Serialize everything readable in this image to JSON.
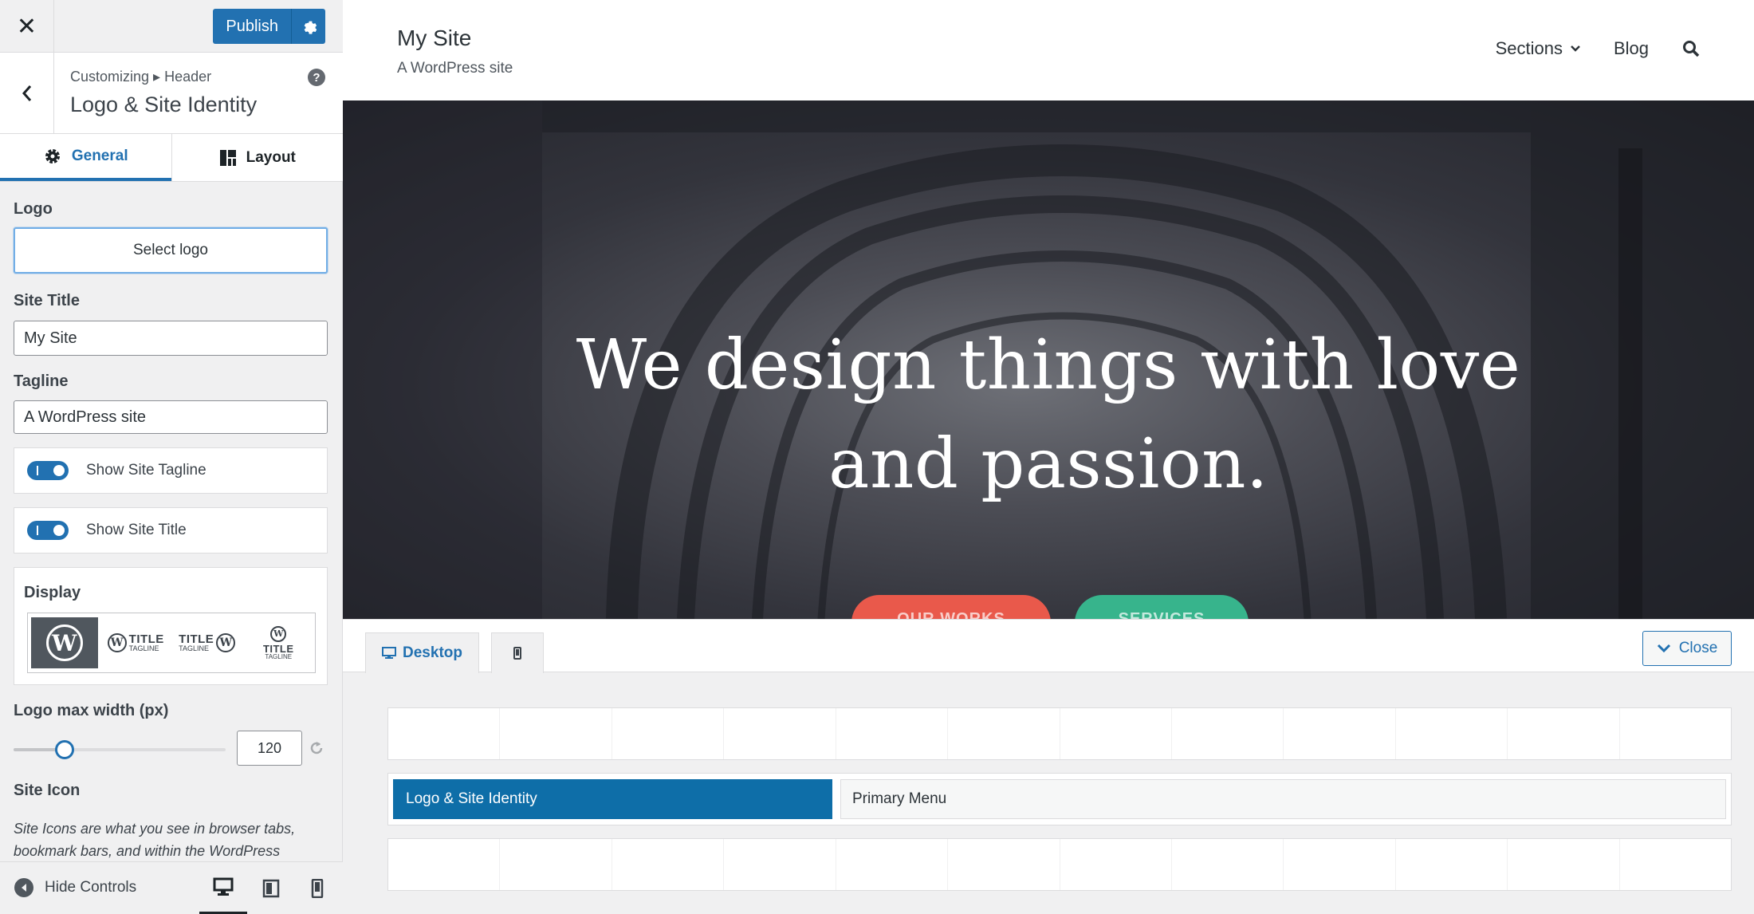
{
  "sidebar": {
    "publish_label": "Publish",
    "breadcrumb": "Customizing ▸ Header",
    "section_title": "Logo & Site Identity",
    "tabs": [
      {
        "label": "General",
        "icon": "gear-icon",
        "active": true
      },
      {
        "label": "Layout",
        "icon": "layout-icon",
        "active": false
      }
    ],
    "logo": {
      "label": "Logo",
      "button": "Select logo"
    },
    "site_title": {
      "label": "Site Title",
      "value": "My Site"
    },
    "tagline": {
      "label": "Tagline",
      "value": "A WordPress site"
    },
    "toggles": [
      {
        "label": "Show Site Tagline",
        "on": true
      },
      {
        "label": "Show Site Title",
        "on": true
      }
    ],
    "display": {
      "label": "Display",
      "options": [
        {
          "title": "",
          "tagline": "",
          "selected": true
        },
        {
          "title": "TITLE",
          "tagline": "TAGLINE",
          "selected": false
        },
        {
          "title": "TITLE",
          "tagline": "TAGLINE",
          "selected": false
        },
        {
          "title": "TITLE",
          "tagline": "TAGLINE",
          "selected": false
        }
      ]
    },
    "logo_max_width": {
      "label": "Logo max width (px)",
      "value": "120",
      "slider_fraction": 0.24
    },
    "site_icon": {
      "label": "Site Icon",
      "description": "Site Icons are what you see in browser tabs, bookmark bars, and within the WordPress"
    },
    "footer": {
      "hide_controls": "Hide Controls",
      "active_device": "desktop"
    }
  },
  "preview": {
    "site_title": "My Site",
    "site_tagline": "A WordPress site",
    "nav": {
      "sections": "Sections",
      "blog": "Blog"
    },
    "hero": {
      "heading_line1": "We design things with love",
      "heading_line2": "and passion.",
      "button1": "OUR WORKS",
      "button2": "SERVICES",
      "button1_color": "#e9594b",
      "button2_color": "#37b48c"
    }
  },
  "builder": {
    "tab_desktop": "Desktop",
    "close_label": "Close",
    "items": {
      "logo": "Logo & Site Identity",
      "menu": "Primary Menu"
    }
  },
  "colors": {
    "accent": "#2271b1",
    "builder_item": "#0e6ea8"
  }
}
